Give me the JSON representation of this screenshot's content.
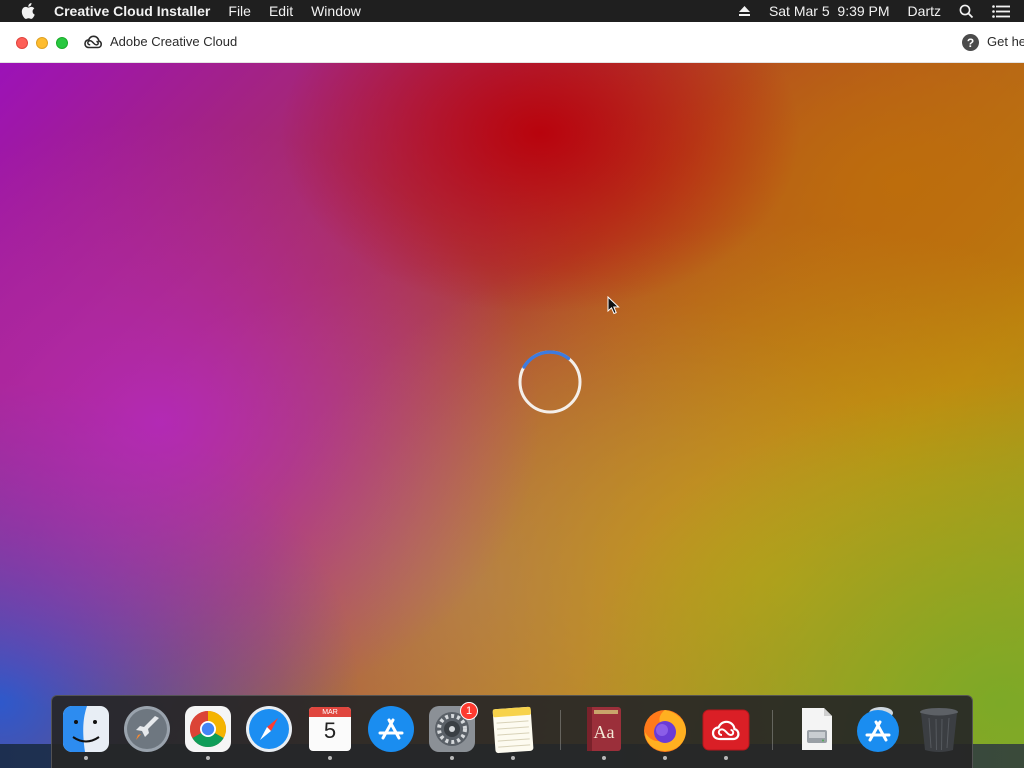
{
  "menubar": {
    "app_name": "Creative Cloud Installer",
    "menus": [
      "File",
      "Edit",
      "Window"
    ],
    "datetime": "Sat Mar 5  9:39 PM",
    "user": "Dartz"
  },
  "window": {
    "title": "Adobe Creative Cloud",
    "help_link": "Get he"
  },
  "content": {
    "status": "loading"
  },
  "dock": {
    "items": [
      {
        "name": "Finder",
        "icon": "finder-icon",
        "running": true
      },
      {
        "name": "Launchpad",
        "icon": "launchpad-icon",
        "running": false
      },
      {
        "name": "Google Chrome",
        "icon": "chrome-icon",
        "running": true
      },
      {
        "name": "Safari",
        "icon": "safari-icon",
        "running": false
      },
      {
        "name": "Calendar",
        "icon": "calendar-icon",
        "running": true,
        "month": "MAR",
        "day": "5"
      },
      {
        "name": "App Store",
        "icon": "app-store-icon",
        "running": false
      },
      {
        "name": "System Preferences",
        "icon": "system-preferences-icon",
        "running": true,
        "badge": "1"
      },
      {
        "name": "Notes",
        "icon": "notes-icon",
        "running": true
      },
      {
        "name": "Dictionary",
        "icon": "dictionary-icon",
        "running": true,
        "label": "Aa"
      },
      {
        "name": "Firefox",
        "icon": "firefox-icon",
        "running": true
      },
      {
        "name": "Adobe Creative Cloud",
        "icon": "creative-cloud-icon",
        "running": true
      },
      {
        "name": "Installer Disk",
        "icon": "disk-image-icon",
        "running": false
      },
      {
        "name": "App Store Download",
        "icon": "app-store-download-icon",
        "running": false
      },
      {
        "name": "Trash",
        "icon": "trash-icon",
        "running": false
      }
    ]
  },
  "colors": {
    "menubar_bg": "#1f1f1f",
    "close": "#fe5f57",
    "minimize": "#febc2e",
    "maximize": "#28c840",
    "spinner_accent": "#3d7be0",
    "badge": "#ff3b30"
  }
}
